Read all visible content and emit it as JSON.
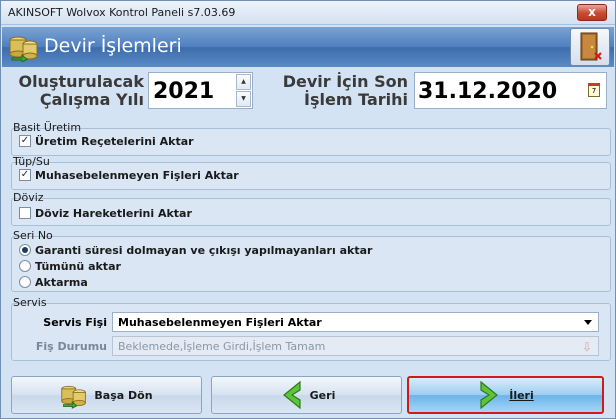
{
  "window": {
    "title": "AKINSOFT Wolvox Kontrol Paneli s7.03.69",
    "close_label": "x"
  },
  "header": {
    "title": "Devir İşlemleri"
  },
  "year": {
    "label_line1": "Oluşturulacak",
    "label_line2": "Çalışma Yılı",
    "value": "2021"
  },
  "date": {
    "label_line1": "Devir İçin Son",
    "label_line2": "İşlem Tarihi",
    "value": "31.12.2020"
  },
  "groups": {
    "basit_uretim": {
      "title": "Basit Üretim",
      "option": "Üretim Reçetelerini Aktar",
      "checked": true
    },
    "tup_su": {
      "title": "Tüp/Su",
      "option": "Muhasebelenmeyen Fişleri Aktar",
      "checked": true
    },
    "doviz": {
      "title": "Döviz",
      "option": "Döviz Hareketlerini Aktar",
      "checked": false
    },
    "seri_no": {
      "title": "Seri No",
      "options": [
        "Garanti süresi dolmayan ve çıkışı yapılmayanları aktar",
        "Tümünü aktar",
        "Aktarma"
      ],
      "selected": 0
    },
    "servis": {
      "title": "Servis",
      "fisi_label": "Servis Fişi",
      "fisi_value": "Muhasebelenmeyen Fişleri Aktar",
      "durum_label": "Fiş Durumu",
      "durum_value": "Beklemede,İşleme Girdi,İşlem Tamam"
    }
  },
  "buttons": {
    "basa_don": "Başa Dön",
    "geri": "Geri",
    "ileri": "İleri"
  },
  "colors": {
    "header_blue": "#4f7fbf",
    "highlight_red": "#d11a1a",
    "primary_button": "#6cb4ea"
  }
}
